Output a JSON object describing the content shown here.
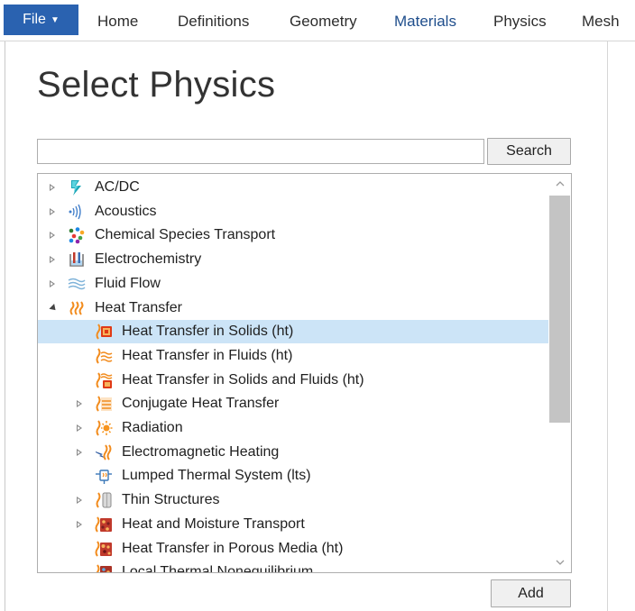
{
  "ribbon": {
    "file_label": "File",
    "tabs": [
      {
        "label": "Home",
        "active": false
      },
      {
        "label": "Definitions",
        "active": false
      },
      {
        "label": "Geometry",
        "active": false
      },
      {
        "label": "Materials",
        "active": true
      },
      {
        "label": "Physics",
        "active": false
      },
      {
        "label": "Mesh",
        "active": false
      }
    ]
  },
  "panel": {
    "title": "Select Physics",
    "search": {
      "value": "",
      "placeholder": "",
      "button_label": "Search"
    },
    "add_label": "Add"
  },
  "colors": {
    "file_tab": "#2a62b0",
    "selection": "#cce4f7",
    "heat_orange": "#f28c1e",
    "heat_red": "#e03a16",
    "acdc_teal": "#1aa6b7",
    "scroll_thumb": "#c4c4c4"
  },
  "tree": [
    {
      "label": "AC/DC",
      "icon": "acdc-icon",
      "expander": "collapsed",
      "level": 0
    },
    {
      "label": "Acoustics",
      "icon": "acoustics-icon",
      "expander": "collapsed",
      "level": 0
    },
    {
      "label": "Chemical Species Transport",
      "icon": "chemical-species-icon",
      "expander": "collapsed",
      "level": 0
    },
    {
      "label": "Electrochemistry",
      "icon": "electrochemistry-icon",
      "expander": "collapsed",
      "level": 0
    },
    {
      "label": "Fluid Flow",
      "icon": "fluid-flow-icon",
      "expander": "collapsed",
      "level": 0
    },
    {
      "label": "Heat Transfer",
      "icon": "heat-transfer-icon",
      "expander": "expanded",
      "level": 0
    },
    {
      "label": "Heat Transfer in Solids (ht)",
      "icon": "heat-solids-icon",
      "expander": "none",
      "level": 1,
      "selected": true
    },
    {
      "label": "Heat Transfer in Fluids (ht)",
      "icon": "heat-fluids-icon",
      "expander": "none",
      "level": 1
    },
    {
      "label": "Heat Transfer in Solids and Fluids (ht)",
      "icon": "heat-solids-fluids-icon",
      "expander": "none",
      "level": 1
    },
    {
      "label": "Conjugate Heat Transfer",
      "icon": "conjugate-heat-icon",
      "expander": "collapsed",
      "level": 1
    },
    {
      "label": "Radiation",
      "icon": "radiation-icon",
      "expander": "collapsed",
      "level": 1
    },
    {
      "label": "Electromagnetic Heating",
      "icon": "em-heating-icon",
      "expander": "collapsed",
      "level": 1
    },
    {
      "label": "Lumped Thermal System (lts)",
      "icon": "lumped-thermal-icon",
      "expander": "none",
      "level": 1
    },
    {
      "label": "Thin Structures",
      "icon": "thin-structures-icon",
      "expander": "collapsed",
      "level": 1
    },
    {
      "label": "Heat and Moisture Transport",
      "icon": "heat-moisture-icon",
      "expander": "collapsed",
      "level": 1
    },
    {
      "label": "Heat Transfer in Porous Media (ht)",
      "icon": "porous-media-icon",
      "expander": "none",
      "level": 1
    },
    {
      "label": "Local Thermal Nonequilibrium",
      "icon": "thermal-noneq-icon",
      "expander": "none",
      "level": 1
    }
  ]
}
